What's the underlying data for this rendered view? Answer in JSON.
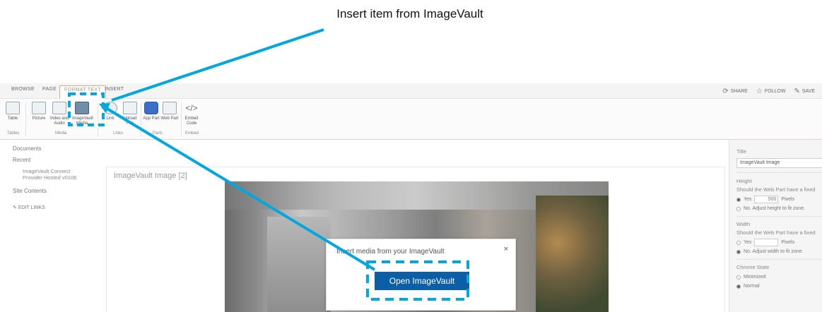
{
  "callout": {
    "title": "Insert item from ImageVault"
  },
  "tabs": [
    "BROWSE",
    "PAGE",
    "FORMAT TEXT",
    "INSERT"
  ],
  "top_actions": [
    {
      "label": "SHARE",
      "icon": "share-icon"
    },
    {
      "label": "FOLLOW",
      "icon": "star-icon"
    },
    {
      "label": "SAVE",
      "icon": "save-icon"
    }
  ],
  "ribbon": {
    "buttons": [
      {
        "label": "Table",
        "icon": "table-icon"
      },
      {
        "label": "Picture",
        "icon": "picture-icon"
      },
      {
        "label": "Video and Audio",
        "icon": "video-icon"
      },
      {
        "label": "ImageVault Media",
        "icon": "imagevault-icon"
      },
      {
        "label": "Link",
        "icon": "link-icon"
      },
      {
        "label": "Upload File",
        "icon": "upload-icon"
      },
      {
        "label": "App Part",
        "icon": "app-part-icon"
      },
      {
        "label": "Web Part",
        "icon": "web-part-icon"
      },
      {
        "label": "Embed Code",
        "icon": "embed-code-icon"
      }
    ],
    "groups": [
      "Tables",
      "Media",
      "Links",
      "Parts",
      "Embed"
    ]
  },
  "nav": {
    "documents": "Documents",
    "recent": "Recent",
    "recent_item_1": "ImageVault Connect",
    "recent_item_2": "Provider Hosted v0106",
    "site_contents": "Site Contents",
    "edit_links": "EDIT LINKS"
  },
  "content": {
    "webpart_title": "ImageVault Image [2]",
    "dialog_title": "Insert media from your ImageVault",
    "dialog_close": "×",
    "open_button": "Open ImageVault"
  },
  "panel": {
    "title_label": "Title",
    "title_value": "ImageVault Image",
    "height_label": "Height",
    "height_question": "Should the Web Part have a fixed",
    "height_yes": "Yes",
    "height_value": "500",
    "height_unit": "Pixels",
    "height_no": "No. Adjust height to fit zone.",
    "width_label": "Width",
    "width_question": "Should the Web Part have a fixed",
    "width_yes": "Yes",
    "width_unit": "Pixels",
    "width_no": "No. Adjust width to fit zone.",
    "chrome_label": "Chrome State",
    "chrome_min": "Minimized",
    "chrome_normal": "Normal"
  },
  "colors": {
    "annotation": "#00a7e1",
    "button": "#0b5fa8"
  }
}
